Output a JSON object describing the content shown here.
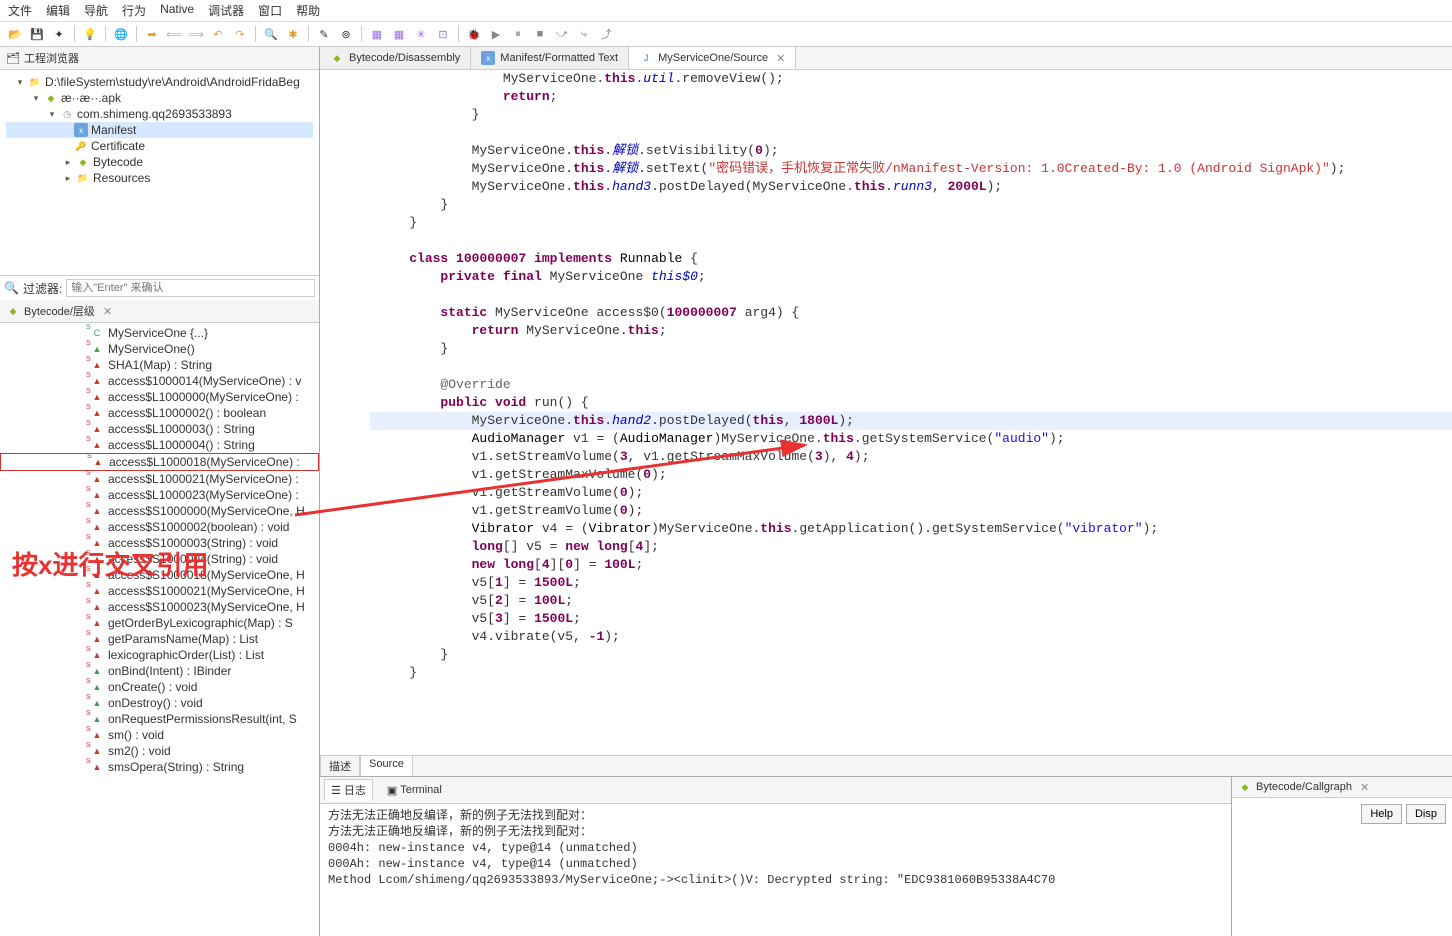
{
  "menu": [
    "文件",
    "编辑",
    "导航",
    "行为",
    "Native",
    "调试器",
    "窗口",
    "帮助"
  ],
  "panel": {
    "explorer": "工程浏览器",
    "hierarchy": "Bytecode/层级",
    "callgraph": "Bytecode/Callgraph"
  },
  "tree": {
    "root": "D:\\fileSystem\\study\\re\\Android\\AndroidFridaBeg",
    "apk": "æ··æ··.apk",
    "pkg": "com.shimeng.qq2693533893",
    "manifest": "Manifest",
    "cert": "Certificate",
    "bytecode": "Bytecode",
    "resources": "Resources"
  },
  "filter": {
    "label": "过滤器:",
    "placeholder": "输入\"Enter\" 来确认"
  },
  "hier": [
    {
      "t": "MyServiceOne {...}",
      "k": "cls"
    },
    {
      "t": "MyServiceOne()",
      "k": "green"
    },
    {
      "t": "SHA1(Map) : String",
      "k": "method"
    },
    {
      "t": "access$1000014(MyServiceOne) : v",
      "k": "method"
    },
    {
      "t": "access$L1000000(MyServiceOne) :",
      "k": "method"
    },
    {
      "t": "access$L1000002() : boolean",
      "k": "method"
    },
    {
      "t": "access$L1000003() : String",
      "k": "method"
    },
    {
      "t": "access$L1000004() : String",
      "k": "method"
    },
    {
      "t": "access$L1000018(MyServiceOne) :",
      "k": "method",
      "hl": true
    },
    {
      "t": "access$L1000021(MyServiceOne) :",
      "k": "method"
    },
    {
      "t": "access$L1000023(MyServiceOne) :",
      "k": "method"
    },
    {
      "t": "access$S1000000(MyServiceOne, H",
      "k": "method"
    },
    {
      "t": "access$S1000002(boolean) : void",
      "k": "method"
    },
    {
      "t": "access$S1000003(String) : void",
      "k": "method"
    },
    {
      "t": "access$S1000004(String) : void",
      "k": "method"
    },
    {
      "t": "access$S1000018(MyServiceOne, H",
      "k": "method"
    },
    {
      "t": "access$S1000021(MyServiceOne, H",
      "k": "method"
    },
    {
      "t": "access$S1000023(MyServiceOne, H",
      "k": "method"
    },
    {
      "t": "getOrderByLexicographic(Map) : S",
      "k": "method"
    },
    {
      "t": "getParamsName(Map) : List",
      "k": "method"
    },
    {
      "t": "lexicographicOrder(List) : List",
      "k": "method"
    },
    {
      "t": "onBind(Intent) : IBinder",
      "k": "green"
    },
    {
      "t": "onCreate() : void",
      "k": "green"
    },
    {
      "t": "onDestroy() : void",
      "k": "green"
    },
    {
      "t": "onRequestPermissionsResult(int, S",
      "k": "green"
    },
    {
      "t": "sm() : void",
      "k": "method"
    },
    {
      "t": "sm2() : void",
      "k": "method"
    },
    {
      "t": "smsOpera(String) : String",
      "k": "method"
    }
  ],
  "tabs": [
    {
      "label": "Bytecode/Disassembly",
      "ico": "android"
    },
    {
      "label": "Manifest/Formatted Text",
      "ico": "xml"
    },
    {
      "label": "MyServiceOne/Source",
      "ico": "java",
      "active": true,
      "close": true
    }
  ],
  "subTabs": {
    "desc": "描述",
    "src": "Source"
  },
  "bottomTabs": {
    "log": "日志",
    "term": "Terminal"
  },
  "log": [
    "方法无法正确地反编译，新的例子无法找到配对：",
    "方法无法正确地反编译，新的例子无法找到配对：",
    "0004h: new-instance v4, type@14 (unmatched)",
    "000Ah: new-instance v4, type@14 (unmatched)",
    "Method Lcom/shimeng/qq2693533893/MyServiceOne;-><clinit>()V: Decrypted string: \"EDC9381060B95338A4C70"
  ],
  "cg": {
    "help": "Help",
    "disp": "Disp"
  },
  "anno": "按x进行交叉引用"
}
